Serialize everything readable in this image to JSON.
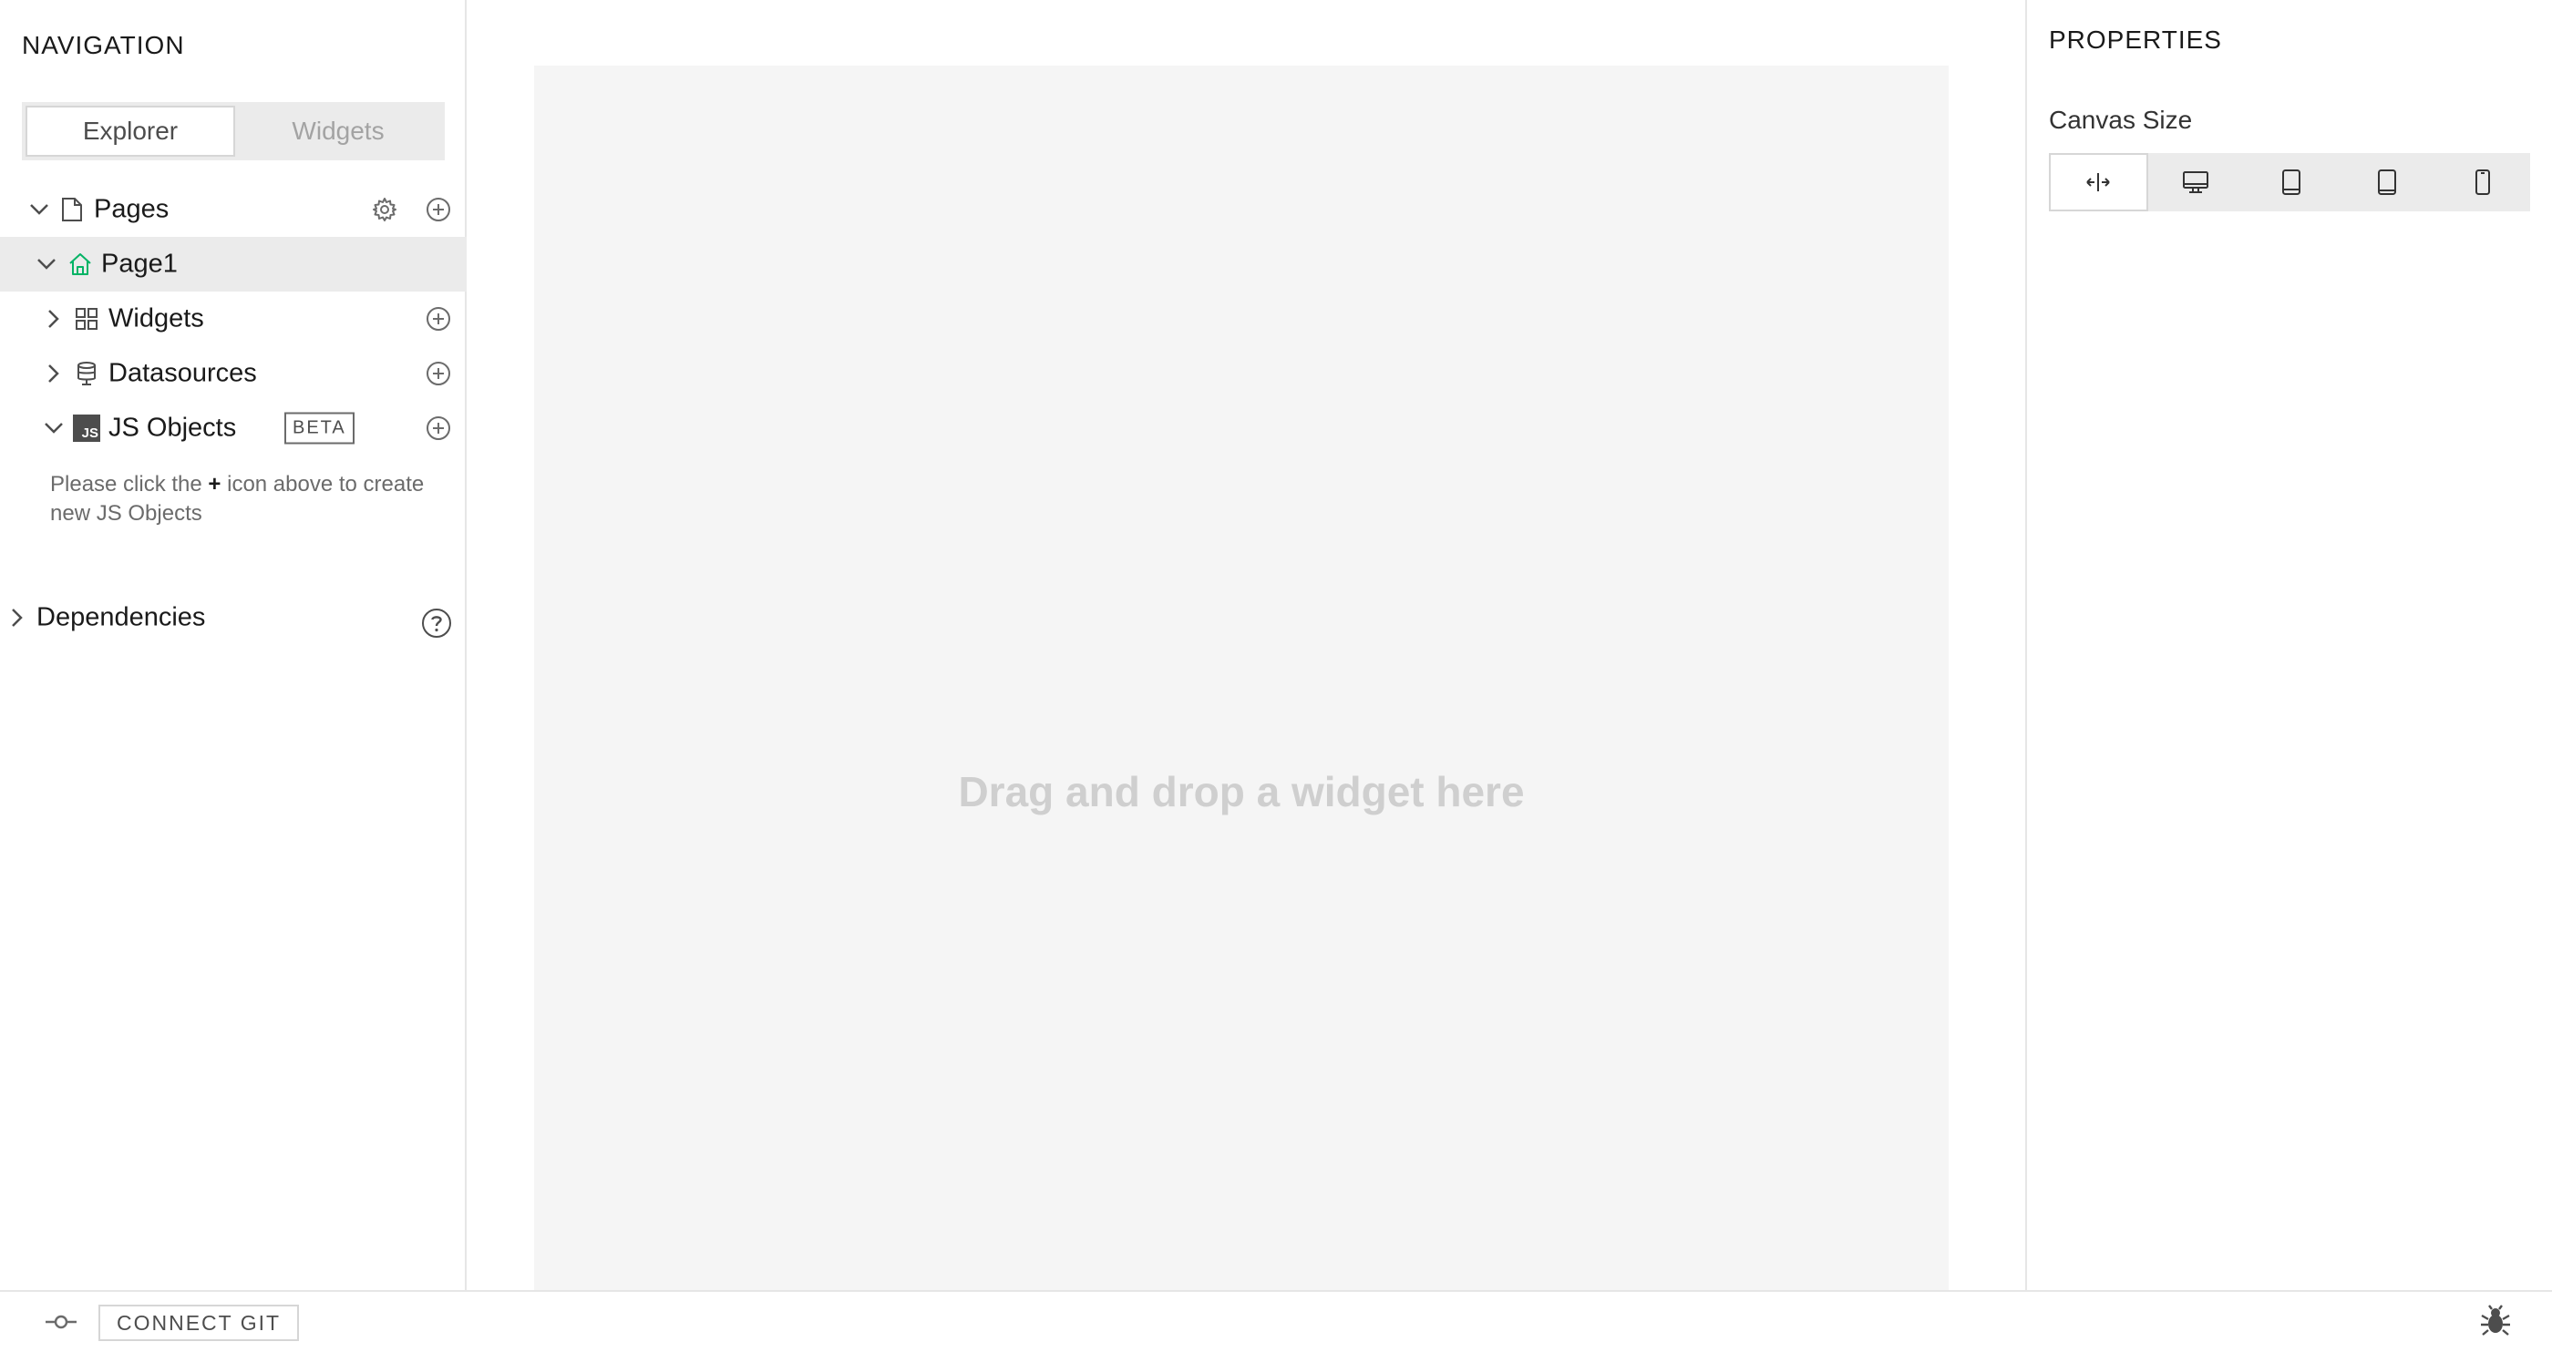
{
  "navigation": {
    "title": "NAVIGATION",
    "tabs": [
      {
        "label": "Explorer",
        "active": true
      },
      {
        "label": "Widgets",
        "active": false
      }
    ]
  },
  "explorer": {
    "pages_label": "Pages",
    "page1_label": "Page1",
    "widgets_label": "Widgets",
    "datasources_label": "Datasources",
    "js_objects_label": "JS Objects",
    "js_icon_text": "JS",
    "beta_label": "BETA",
    "empty_hint_prefix": "Please click the ",
    "empty_hint_plus": "+",
    "empty_hint_suffix": " icon above to create new JS Objects",
    "dependencies_label": "Dependencies"
  },
  "canvas": {
    "placeholder": "Drag and drop a widget here"
  },
  "properties": {
    "title": "PROPERTIES",
    "canvas_size_label": "Canvas Size",
    "size_options": [
      "fluid-width-icon",
      "desktop-icon",
      "tablet-landscape-icon",
      "tablet-icon",
      "mobile-icon"
    ],
    "selected_size": "fluid-width-icon"
  },
  "bottom_bar": {
    "connect_git_label": "CONNECT GIT"
  },
  "colors": {
    "accent_home": "#03b365",
    "selected_row_bg": "#ebebeb",
    "canvas_bg": "#f5f5f5"
  }
}
